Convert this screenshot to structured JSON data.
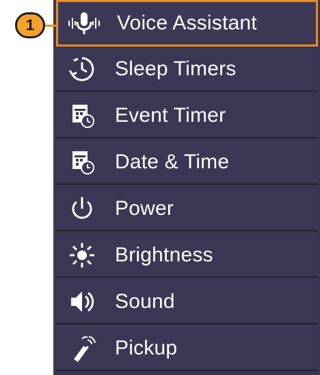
{
  "callout": {
    "number": "1"
  },
  "menu": {
    "items": [
      {
        "label": "Voice Assistant",
        "icon": "microphone-icon",
        "selected": true
      },
      {
        "label": "Sleep Timers",
        "icon": "sleep-timer-icon",
        "selected": false
      },
      {
        "label": "Event Timer",
        "icon": "event-timer-icon",
        "selected": false
      },
      {
        "label": "Date & Time",
        "icon": "calendar-clock-icon",
        "selected": false
      },
      {
        "label": "Power",
        "icon": "power-icon",
        "selected": false
      },
      {
        "label": "Brightness",
        "icon": "brightness-icon",
        "selected": false
      },
      {
        "label": "Sound",
        "icon": "speaker-icon",
        "selected": false
      },
      {
        "label": "Pickup",
        "icon": "remote-pickup-icon",
        "selected": false
      }
    ]
  },
  "colors": {
    "panel": "#3a3652",
    "highlight_border": "#f28a1a",
    "badge": "#f6a12b",
    "text": "#ffffff"
  }
}
